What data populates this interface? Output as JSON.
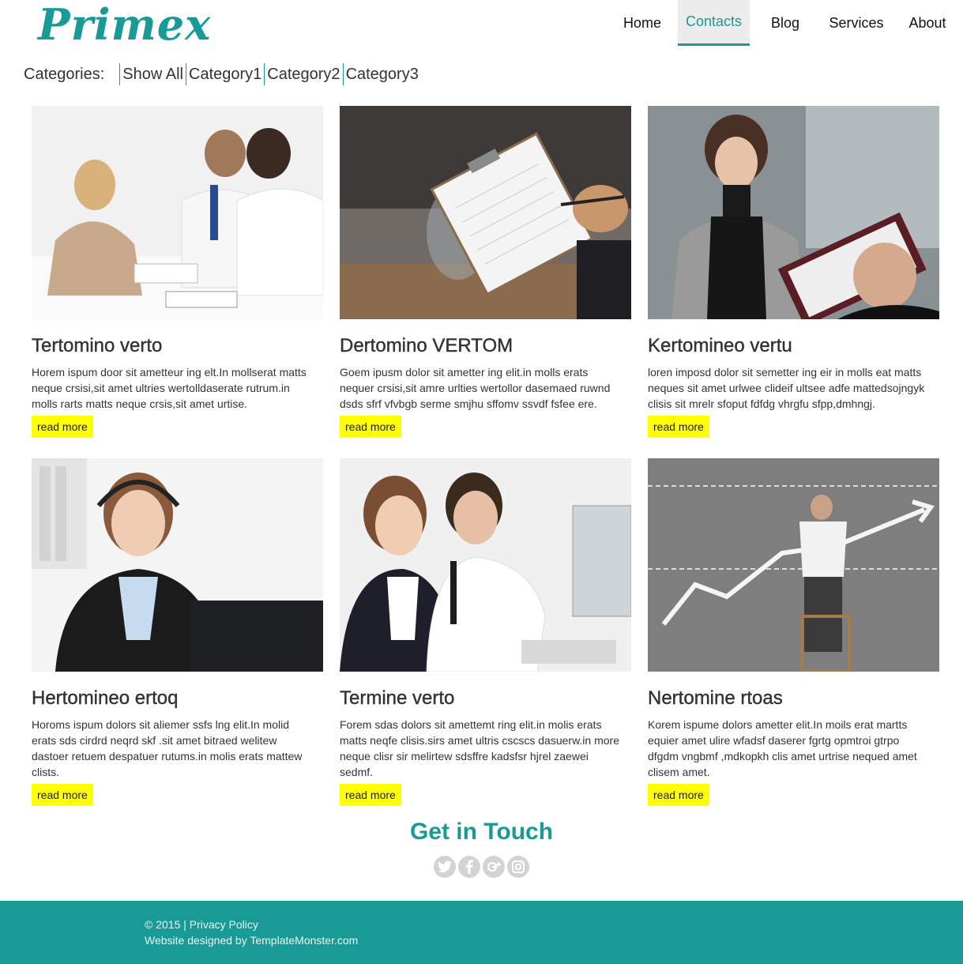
{
  "brand": {
    "logo": "Primex",
    "accent": "#189a96"
  },
  "nav": [
    {
      "label": "Home",
      "active": false
    },
    {
      "label": "Contacts",
      "active": true
    },
    {
      "label": "Blog",
      "active": false
    },
    {
      "label": "Services",
      "active": false
    },
    {
      "label": "About",
      "active": false
    }
  ],
  "categories": {
    "label": "Categories:",
    "items": [
      "Show All",
      "Category1",
      "Category2",
      "Category3"
    ]
  },
  "cards": [
    {
      "title": "Tertomino verto",
      "text": "Horem ispum door sit ametteur ing elt.In mollserat matts neque crsisi,sit amet ultries wertolldaserate rutrum.in molls rarts matts neque crsis,sit amet urtise.",
      "button": "read more"
    },
    {
      "title": "Dertomino VERTOM",
      "text": "Goem ipusm dolor sit ametter ing elit.in molls erats nequer crsisi,sit amre urlties wertollor dasemaed ruwnd dsds sfrf vfvbgb serme smjhu sffomv ssvdf fsfee ere.",
      "button": "read more"
    },
    {
      "title": "Kertomineo vertu",
      "text": "loren imposd dolor sit semetter ing eir in molls eat matts neques sit amet urlwee clideif ultsee adfe mattedsojngyk clisis sit mrelr sfoput fdfdg vhrgfu sfpp,dmhngj.",
      "button": "read more"
    },
    {
      "title": "Hertomineo ertoq",
      "text": "Horoms ispum dolors sit aliemer ssfs lng elit.In molid erats sds cirdrd neqrd skf .sit amet bitraed welitew dastoer retuem despatuer rutums.in molis erats mattew clists.",
      "button": "read more"
    },
    {
      "title": "Termine verto",
      "text": "Forem sdas dolors sit amettemt ring elit.in molis erats matts neqfe clisis.sirs amet ultris cscscs dasuerw.in more neque clisr sir melirtew sdsffre kadsfsr hjrel zaewei sedmf.",
      "button": "read more"
    },
    {
      "title": "Nertomine rtoas",
      "text": "Korem ispume dolors ametter elit.In moils erat martts equier amet ulire wfadsf daserer fgrtg opmtroi gtrpo dfgdm vngbmf ,mdkopkh clis amet urtrise nequed amet clisem amet.",
      "button": "read more"
    }
  ],
  "contact": {
    "heading": "Get in Touch",
    "socials": [
      "twitter-icon",
      "facebook-icon",
      "google-plus-icon",
      "instagram-icon"
    ]
  },
  "footer": {
    "copyright": "© 2015 | ",
    "privacy": "Privacy Policy",
    "designed_prefix": "Website designed by ",
    "designer": "TemplateMonster.com"
  }
}
